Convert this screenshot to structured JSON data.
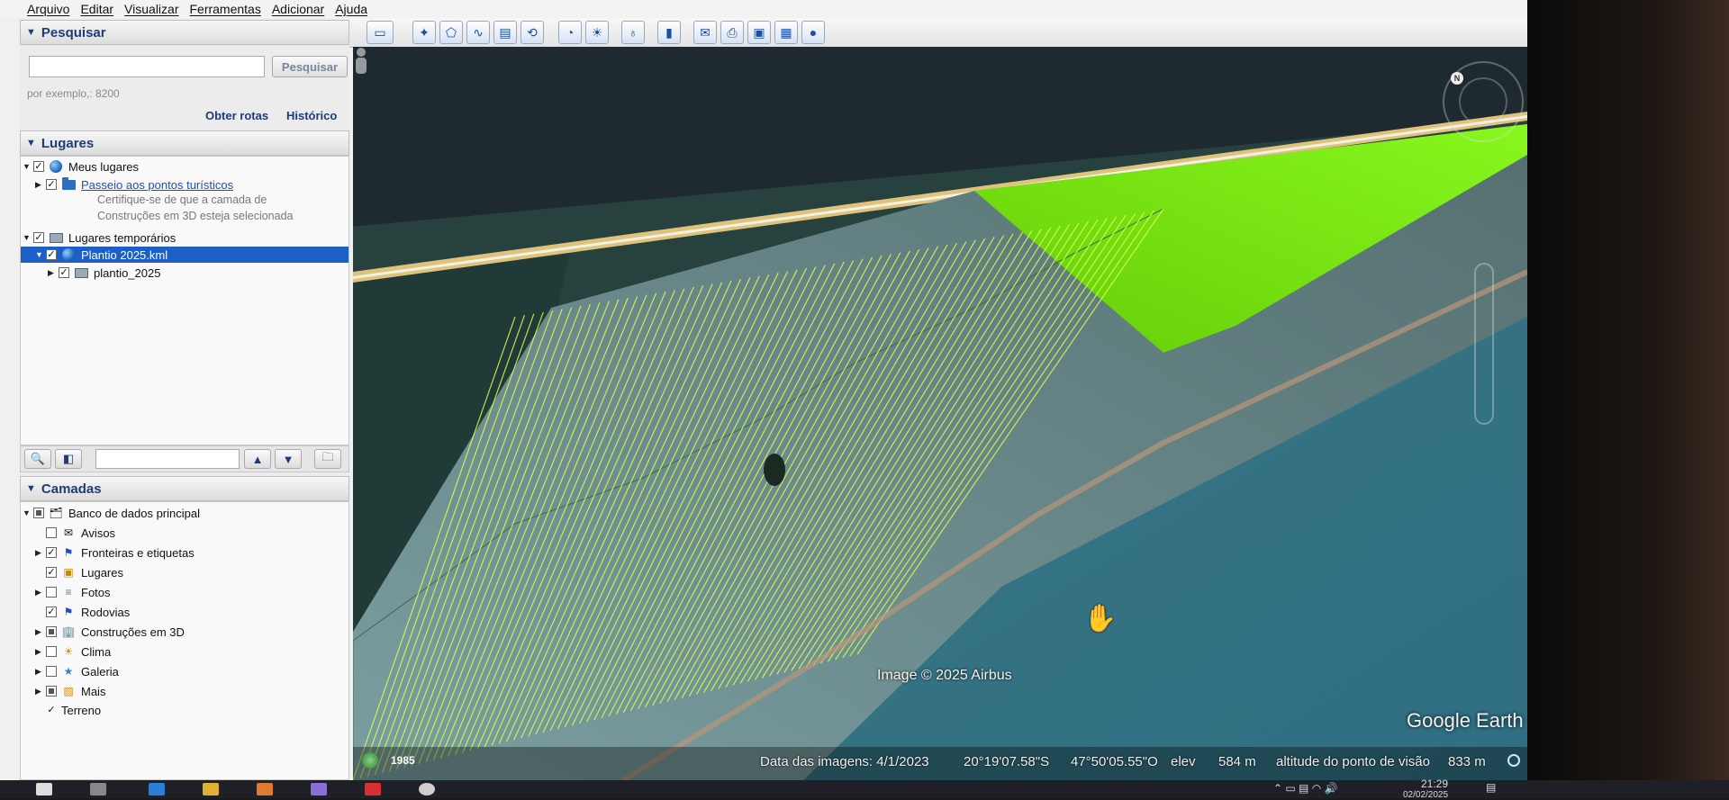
{
  "menu": [
    "Arquivo",
    "Editar",
    "Visualizar",
    "Ferramentas",
    "Adicionar",
    "Ajuda"
  ],
  "search": {
    "header": "Pesquisar",
    "button": "Pesquisar",
    "hint": "por exemplo,: 8200",
    "get_directions": "Obter rotas",
    "history": "Histórico"
  },
  "places": {
    "header": "Lugares",
    "my_places": "Meus lugares",
    "tour": "Passeio aos pontos turísticos",
    "note_line1": "Certifique-se de que a camada de",
    "note_line2": "Construções em 3D esteja selecionada",
    "temp_places": "Lugares temporários",
    "kml": "Plantio 2025.kml",
    "folder": "plantio_2025"
  },
  "layers": {
    "header": "Camadas",
    "items": [
      {
        "label": "Banco de dados principal",
        "icon": "layers-icon"
      },
      {
        "label": "Avisos",
        "icon": "mail-icon"
      },
      {
        "label": "Fronteiras e etiquetas",
        "icon": "flag-icon"
      },
      {
        "label": "Lugares",
        "icon": "places-icon"
      },
      {
        "label": "Fotos",
        "icon": "photos-icon"
      },
      {
        "label": "Rodovias",
        "icon": "road-flag-icon"
      },
      {
        "label": "Construções em 3D",
        "icon": "building-icon"
      },
      {
        "label": "Clima",
        "icon": "sun-icon"
      },
      {
        "label": "Galeria",
        "icon": "star-icon"
      },
      {
        "label": "Mais",
        "icon": "more-icon"
      },
      {
        "label": "Terreno",
        "icon": ""
      }
    ]
  },
  "map": {
    "attribution": "Image © 2025 Airbus",
    "logo": "Google Earth",
    "year": "1985",
    "imagery_date": "Data das imagens: 4/1/2023",
    "lat": "20°19'07.58\"S",
    "lon": "47°50'05.55\"O",
    "elev_label": "elev",
    "elev_value": "584 m",
    "eye_label": "altitude do ponto de visão",
    "eye_value": "833 m"
  },
  "taskbar": {
    "time": "21:29",
    "date": "02/02/2025"
  }
}
